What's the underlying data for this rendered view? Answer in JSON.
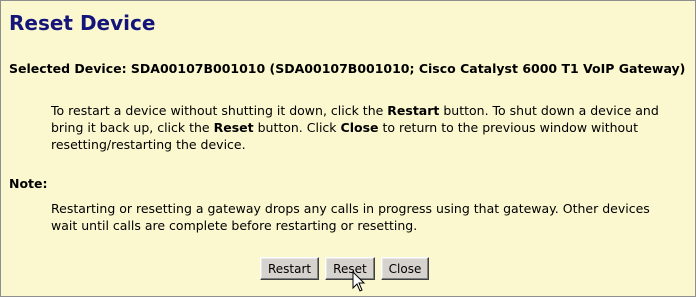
{
  "page": {
    "title": "Reset Device"
  },
  "selected_device": {
    "text": "Selected Device: SDA00107B001010 (SDA00107B001010; Cisco Catalyst 6000 T1 VoIP Gateway)"
  },
  "instructions": {
    "part1": "To restart a device without shutting it down, click the ",
    "restart_word": "Restart",
    "part2": " button. To shut down a device and bring it back up, click the ",
    "reset_word": "Reset",
    "part3": " button. Click ",
    "close_word": "Close",
    "part4": " to return to the previous window without resetting/restarting the device."
  },
  "note": {
    "label": "Note:",
    "text": "Restarting or resetting a gateway drops any calls in progress using that gateway. Other devices wait until calls are complete before restarting or resetting."
  },
  "buttons": {
    "restart_label": "Restart",
    "reset_label": "Reset",
    "close_label": "Close"
  }
}
